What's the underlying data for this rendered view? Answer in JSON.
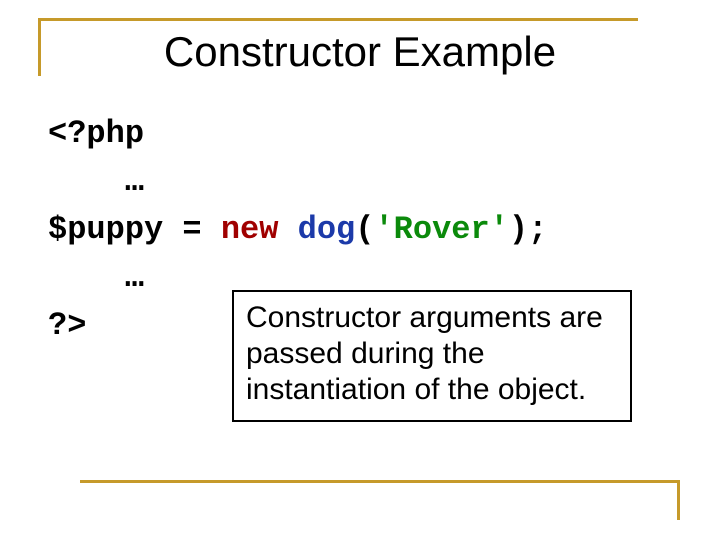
{
  "title": "Constructor Example",
  "code": {
    "open_tag": "<?php",
    "ellipsis1": "    …",
    "var": "$puppy",
    "eq": " = ",
    "kw_new": "new",
    "space_after_new": " ",
    "fn": "dog",
    "paren_open": "(",
    "arg_string": "'Rover'",
    "paren_close_semi": ");",
    "ellipsis2": "    …",
    "close_tag": "?>"
  },
  "callout": {
    "text": "Constructor arguments are passed during the instantiation of the object."
  }
}
